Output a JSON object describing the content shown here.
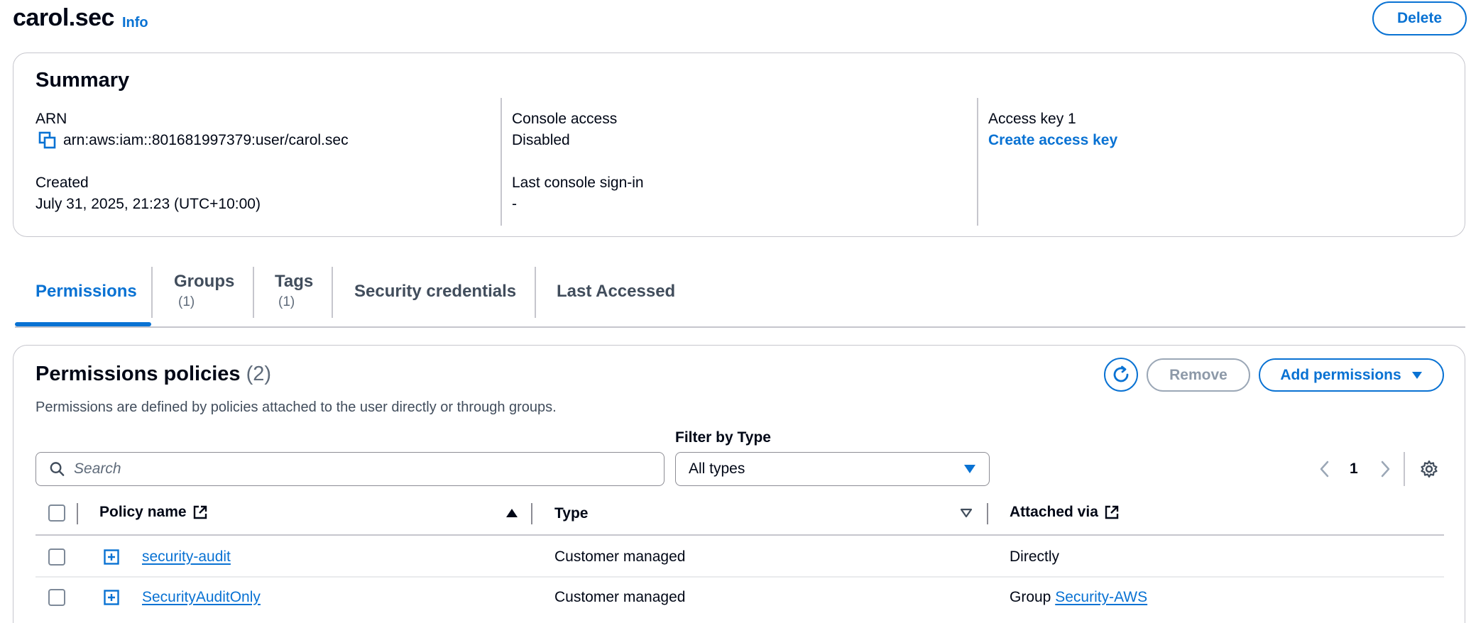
{
  "header": {
    "title": "carol.sec",
    "info_label": "Info",
    "delete_label": "Delete"
  },
  "summary": {
    "heading": "Summary",
    "arn_label": "ARN",
    "arn_value": "arn:aws:iam::801681997379:user/carol.sec",
    "created_label": "Created",
    "created_value": "July 31, 2025, 21:23 (UTC+10:00)",
    "console_access_label": "Console access",
    "console_access_value": "Disabled",
    "last_signin_label": "Last console sign-in",
    "last_signin_value": "-",
    "access_key_label": "Access key 1",
    "create_access_key_label": "Create access key"
  },
  "tabs": [
    {
      "label": "Permissions",
      "count": ""
    },
    {
      "label": "Groups",
      "count": "(1)"
    },
    {
      "label": "Tags",
      "count": "(1)"
    },
    {
      "label": "Security credentials",
      "count": ""
    },
    {
      "label": "Last Accessed",
      "count": ""
    }
  ],
  "permissions": {
    "heading": "Permissions policies",
    "count": "(2)",
    "description": "Permissions are defined by policies attached to the user directly or through groups.",
    "remove_label": "Remove",
    "add_label": "Add permissions",
    "search_placeholder": "Search",
    "filter_label": "Filter by Type",
    "filter_value": "All types",
    "page_number": "1",
    "columns": {
      "policy_name": "Policy name",
      "type": "Type",
      "attached_via": "Attached via"
    },
    "rows": [
      {
        "policy_name": "security-audit",
        "type": "Customer managed",
        "attached_prefix": "",
        "attached_text": "Directly",
        "attached_link": ""
      },
      {
        "policy_name": "SecurityAuditOnly",
        "type": "Customer managed",
        "attached_prefix": "Group",
        "attached_text": "",
        "attached_link": "Security-AWS"
      }
    ]
  },
  "colors": {
    "accent": "#0972d3",
    "text": "#000716",
    "border": "#c6c6cd"
  }
}
